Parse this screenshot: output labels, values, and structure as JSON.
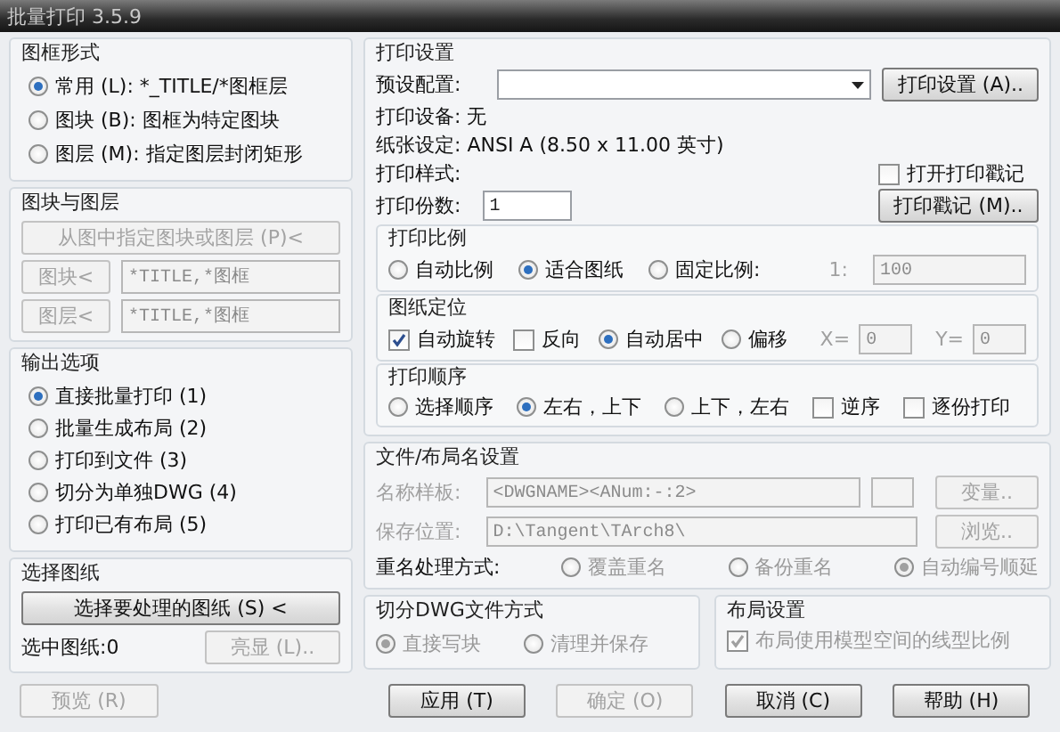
{
  "window": {
    "title": "批量打印 3.5.9"
  },
  "frame_form": {
    "title": "图框形式",
    "options": [
      {
        "label": "常用 (L): *_TITLE/*图框层",
        "selected": true
      },
      {
        "label": "图块 (B): 图框为特定图块",
        "selected": false
      },
      {
        "label": "图层 (M): 指定图层封闭矩形",
        "selected": false
      }
    ]
  },
  "block_layer": {
    "title": "图块与图层",
    "pick_button": {
      "label": "从图中指定图块或图层 (P)<",
      "disabled": true
    },
    "rows": [
      {
        "button": {
          "label": "图块<",
          "disabled": true
        },
        "value": "*TITLE,*图框"
      },
      {
        "button": {
          "label": "图层<",
          "disabled": true
        },
        "value": "*TITLE,*图框"
      }
    ]
  },
  "output": {
    "title": "输出选项",
    "options": [
      {
        "label": "直接批量打印 (1)",
        "selected": true
      },
      {
        "label": "批量生成布局 (2)",
        "selected": false
      },
      {
        "label": "打印到文件 (3)",
        "selected": false
      },
      {
        "label": "切分为单独DWG (4)",
        "selected": false
      },
      {
        "label": "打印已有布局 (5)",
        "selected": false
      }
    ]
  },
  "select_sheets": {
    "title": "选择图纸",
    "select_button": {
      "label": "选择要处理的图纸 (S) <",
      "disabled": false
    },
    "count": "选中图纸:0",
    "highlight_button": {
      "label": "亮显 (L)..",
      "disabled": true
    }
  },
  "print_settings": {
    "title": "打印设置",
    "preset_label": "预设配置:",
    "settings_button": {
      "label": "打印设置 (A)..",
      "disabled": false
    },
    "device": "打印设备: 无",
    "paper": "纸张设定: ANSI A (8.50 x 11.00 英寸)",
    "style": "打印样式:",
    "copies_label": "打印份数:",
    "copies_value": "1",
    "stamp_check": {
      "label": "打开打印戳记",
      "checked": false
    },
    "stamp_button": {
      "label": "打印戳记 (M)..",
      "disabled": false
    },
    "scale": {
      "title": "打印比例",
      "options": [
        {
          "label": "自动比例",
          "selected": false
        },
        {
          "label": "适合图纸",
          "selected": true
        },
        {
          "label": "固定比例:",
          "selected": false
        }
      ],
      "ratio_label": "1:",
      "ratio_value": "100"
    },
    "position": {
      "title": "图纸定位",
      "items": [
        {
          "kind": "checkbox",
          "label": "自动旋转",
          "checked": true
        },
        {
          "kind": "checkbox",
          "label": "反向",
          "checked": false
        },
        {
          "kind": "radio",
          "label": "自动居中",
          "selected": true
        },
        {
          "kind": "radio",
          "label": "偏移",
          "selected": false
        }
      ],
      "x_label": "X=",
      "x_value": "0",
      "y_label": "Y=",
      "y_value": "0"
    },
    "order": {
      "title": "打印顺序",
      "items": [
        {
          "kind": "radio",
          "label": "选择顺序",
          "selected": false
        },
        {
          "kind": "radio",
          "label": "左右，上下",
          "selected": true
        },
        {
          "kind": "radio",
          "label": "上下，左右",
          "selected": false
        },
        {
          "kind": "checkbox",
          "label": "逆序",
          "checked": false
        },
        {
          "kind": "checkbox",
          "label": "逐份打印",
          "checked": false
        }
      ]
    }
  },
  "file_name": {
    "title": "文件/布局名设置",
    "disabled": true,
    "template_label": "名称样板:",
    "template_value": "<DWGNAME><ANum:-:2>",
    "variables_button": {
      "label": "变量..",
      "disabled": true
    },
    "location_label": "保存位置:",
    "location_value": "D:\\Tangent\\TArch8\\",
    "browse_button": {
      "label": "浏览..",
      "disabled": true
    },
    "rename_label": "重名处理方式:",
    "rename_options": [
      {
        "label": "覆盖重名",
        "selected": false
      },
      {
        "label": "备份重名",
        "selected": false
      },
      {
        "label": "自动编号顺延",
        "selected": true
      }
    ]
  },
  "split_dwg": {
    "title": "切分DWG文件方式",
    "disabled": true,
    "options": [
      {
        "label": "直接写块",
        "selected": true
      },
      {
        "label": "清理并保存",
        "selected": false
      }
    ]
  },
  "layout": {
    "title": "布局设置",
    "disabled": true,
    "check": {
      "label": "布局使用模型空间的线型比例",
      "checked": true
    }
  },
  "preview_button": {
    "label": "预览 (R)",
    "disabled": true
  },
  "buttons": [
    {
      "label": "应用 (T)",
      "disabled": false
    },
    {
      "label": "确定 (O)",
      "disabled": true
    },
    {
      "label": "取消 (C)",
      "disabled": false
    },
    {
      "label": "帮助 (H)",
      "disabled": false
    }
  ]
}
